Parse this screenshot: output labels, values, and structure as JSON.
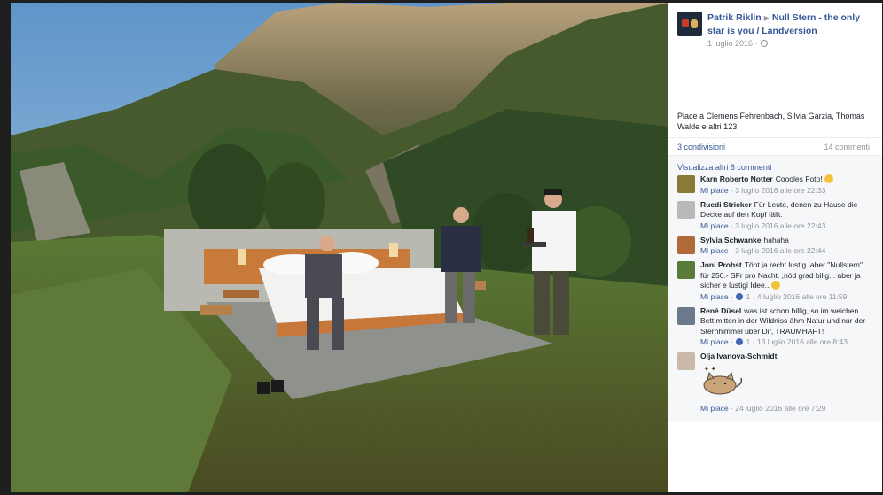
{
  "post": {
    "author": "Patrik Riklin",
    "target": "Null Stern - the only star is you / Landversion",
    "date": "1 luglio 2016 ·"
  },
  "likes_text": "Piace a Clemens Fehrenbach, Silvia Garzia, Thomas Walde e altri 123.",
  "shares_label": "3 condivisioni",
  "comments_count_label": "14 commenti",
  "more_comments_label": "Visualizza altri 8 commenti",
  "comments": [
    {
      "name": "Karn Roberto Notter",
      "text": "Coooles Foto!",
      "like_label": "Mi piace",
      "meta": "· 3 luglio 2016 alle ore 22:33",
      "reactions": "",
      "avatar_color": "#8a7a3a",
      "emoji": true
    },
    {
      "name": "Ruedi Stricker",
      "text": "Für Leute, denen zu Hause die Decke auf den Kopf fällt.",
      "like_label": "Mi piace",
      "meta": "· 3 luglio 2016 alle ore 22:43",
      "reactions": "",
      "avatar_color": "#b9b9b9",
      "emoji": false
    },
    {
      "name": "Sylvia Schwanke",
      "text": "hahaha",
      "like_label": "Mi piace",
      "meta": "· 3 luglio 2016 alle ore 22:44",
      "reactions": "",
      "avatar_color": "#b06a3a",
      "emoji": false
    },
    {
      "name": "Joni Probst",
      "text": "Tönt ja recht lustig. aber \"Nullstern\" für 250.- SFr pro Nacht. ,nöd grad bilig... aber ja sicher e lustigi Idee...",
      "like_label": "Mi piace",
      "meta": "· 4 luglio 2016 alle ore 11:59",
      "reactions": "1",
      "avatar_color": "#5a7a3a",
      "emoji": true
    },
    {
      "name": "René Düsel",
      "text": "was ist schon billig, so im weichen Bett mitten in der Wildniss ähm Natur und nur der Sternhimmel über Dir, TRAUMHAFT!",
      "like_label": "Mi piace",
      "meta": "· 13 luglio 2016 alle ore 8:43",
      "reactions": "1",
      "avatar_color": "#6a7a8a",
      "emoji": false
    },
    {
      "name": "Olja Ivanova-Schmidt",
      "text": "",
      "like_label": "Mi piace",
      "meta": "· 24 luglio 2016 alle ore 7:29",
      "reactions": "",
      "avatar_color": "#c9b9a9",
      "emoji": false
    }
  ],
  "colors": {
    "link": "#365899",
    "muted": "#90949c",
    "comments_bg": "#f6f7f9",
    "like_blue": "#4267b2"
  }
}
